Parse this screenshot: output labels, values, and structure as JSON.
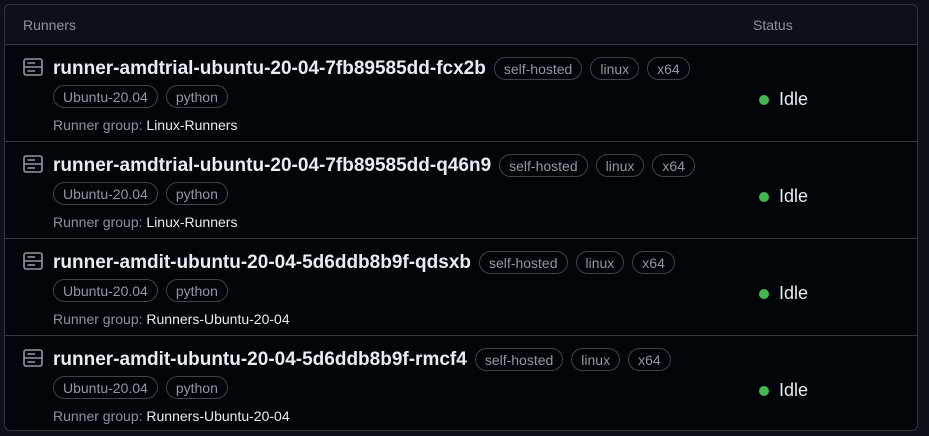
{
  "header": {
    "runners_label": "Runners",
    "status_label": "Status"
  },
  "colors": {
    "status_idle": "#3fb950",
    "background": "#010409",
    "border": "#30363d"
  },
  "runners": [
    {
      "name": "runner-amdtrial-ubuntu-20-04-7fb89585dd-fcx2b",
      "labels": [
        "self-hosted",
        "linux",
        "x64"
      ],
      "extra_labels": [
        "Ubuntu-20.04",
        "python"
      ],
      "group_prefix": "Runner group: ",
      "group": "Linux-Runners",
      "status": "Idle",
      "icon": "server-icon"
    },
    {
      "name": "runner-amdtrial-ubuntu-20-04-7fb89585dd-q46n9",
      "labels": [
        "self-hosted",
        "linux",
        "x64"
      ],
      "extra_labels": [
        "Ubuntu-20.04",
        "python"
      ],
      "group_prefix": "Runner group: ",
      "group": "Linux-Runners",
      "status": "Idle",
      "icon": "server-icon"
    },
    {
      "name": "runner-amdit-ubuntu-20-04-5d6ddb8b9f-qdsxb",
      "labels": [
        "self-hosted",
        "linux",
        "x64"
      ],
      "extra_labels": [
        "Ubuntu-20.04",
        "python"
      ],
      "group_prefix": "Runner group: ",
      "group": "Runners-Ubuntu-20-04",
      "status": "Idle",
      "icon": "server-icon"
    },
    {
      "name": "runner-amdit-ubuntu-20-04-5d6ddb8b9f-rmcf4",
      "labels": [
        "self-hosted",
        "linux",
        "x64"
      ],
      "extra_labels": [
        "Ubuntu-20.04",
        "python"
      ],
      "group_prefix": "Runner group: ",
      "group": "Runners-Ubuntu-20-04",
      "status": "Idle",
      "icon": "server-icon"
    }
  ]
}
